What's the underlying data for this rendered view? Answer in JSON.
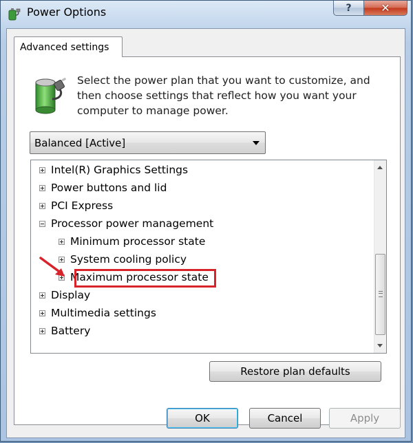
{
  "window": {
    "title": "Power Options",
    "help_label": "?",
    "close_label": "✕"
  },
  "tabs": [
    {
      "label": "Advanced settings",
      "active": true
    }
  ],
  "description": "Select the power plan that you want to customize, and then choose settings that reflect how you want your computer to manage power.",
  "plan_select": {
    "value": "Balanced [Active]"
  },
  "tree": {
    "items": [
      {
        "label": "Intel(R) Graphics Settings",
        "expanded": false,
        "level": 0
      },
      {
        "label": "Power buttons and lid",
        "expanded": false,
        "level": 0
      },
      {
        "label": "PCI Express",
        "expanded": false,
        "level": 0
      },
      {
        "label": "Processor power management",
        "expanded": true,
        "level": 0
      },
      {
        "label": "Minimum processor state",
        "expanded": false,
        "level": 1
      },
      {
        "label": "System cooling policy",
        "expanded": false,
        "level": 1
      },
      {
        "label": "Maximum processor state",
        "expanded": false,
        "level": 1,
        "highlighted": true
      },
      {
        "label": "Display",
        "expanded": false,
        "level": 0
      },
      {
        "label": "Multimedia settings",
        "expanded": false,
        "level": 0
      },
      {
        "label": "Battery",
        "expanded": false,
        "level": 0
      }
    ]
  },
  "buttons": {
    "restore": "Restore plan defaults",
    "ok": "OK",
    "cancel": "Cancel",
    "apply": "Apply"
  },
  "colors": {
    "highlight_box": "#d7242b",
    "annotation_arrow": "#d7242b"
  }
}
